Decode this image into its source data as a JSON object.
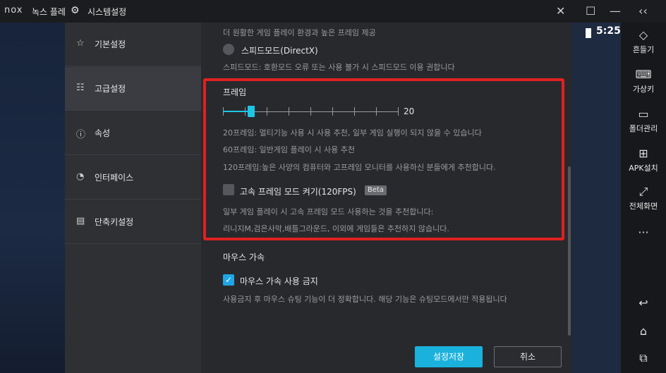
{
  "titlebar": {
    "logo": "nox",
    "app_name": "녹스 플레",
    "window_title": "시스템설정",
    "buttons": {
      "collapse": "‹‹",
      "minimize": "—",
      "close": "✕",
      "maximize": "☐"
    }
  },
  "status_bar": {
    "time": "5:25"
  },
  "toolbar": {
    "items": [
      {
        "label": "흔들기",
        "icon": "◇"
      },
      {
        "label": "가상키",
        "icon": "⌨"
      },
      {
        "label": "폴더관리",
        "icon": "▭"
      },
      {
        "label": "APK설치",
        "icon": "⊞"
      },
      {
        "label": "전체화면",
        "icon": "⤢"
      }
    ],
    "more": "···",
    "nav": {
      "back": "↩",
      "home": "⌂",
      "recent": "⧉"
    }
  },
  "sidebar": {
    "items": [
      {
        "label": "기본설정",
        "icon": "☆"
      },
      {
        "label": "고급설정",
        "icon": "☷"
      },
      {
        "label": "속성",
        "icon": "ⓘ"
      },
      {
        "label": "인터페이스",
        "icon": "◔"
      },
      {
        "label": "단축키설정",
        "icon": "▤"
      }
    ]
  },
  "content": {
    "top_desc": "더 원활한 게임 플레이 환경과 높은 프레임 제공",
    "speed_mode_label": "스피드모드(DirectX)",
    "speed_mode_note": "스피드모드: 호환모드 오류 또는 사용 불가 시 스피드모드 이용 권합니다",
    "frame": {
      "title": "프레임",
      "value": "20",
      "slider_fraction": 0.16,
      "desc_1": "20프레임: 멀티기능 사용 시 사용 추천, 일부 게임 실행이 되지 않을 수 있습니다",
      "desc_2": "60프레임: 일반게임 플레이 시 사용 추천",
      "desc_3": "120프레임:높은 사양의 컴퓨터와 고프레임 모니터를 사용하신 분들에게 추천합니다.",
      "high_fps_label": "고속 프레임 모드 켜기(120FPS)",
      "beta": "Beta",
      "high_fps_note_1": "일부 게임 플레이 시 고속 프레임 모드 사용하는 것을 추천합니다:",
      "high_fps_note_2": "리니지M,검은사막,배틀그라운드, 이외에 게임들은 추천하지 않습니다."
    },
    "mouse": {
      "title": "마우스 가속",
      "disable_label": "마우스 가속 사용 금지",
      "note": "사용금지 후 마우스 슈팅 기능이 더 정확합니다. 해당 기능은 슈팅모드에서만 적용됩니다"
    }
  },
  "footer": {
    "save": "설정저장",
    "cancel": "취소"
  },
  "colors": {
    "accent": "#1ab2dc",
    "highlight": "#e02020"
  }
}
